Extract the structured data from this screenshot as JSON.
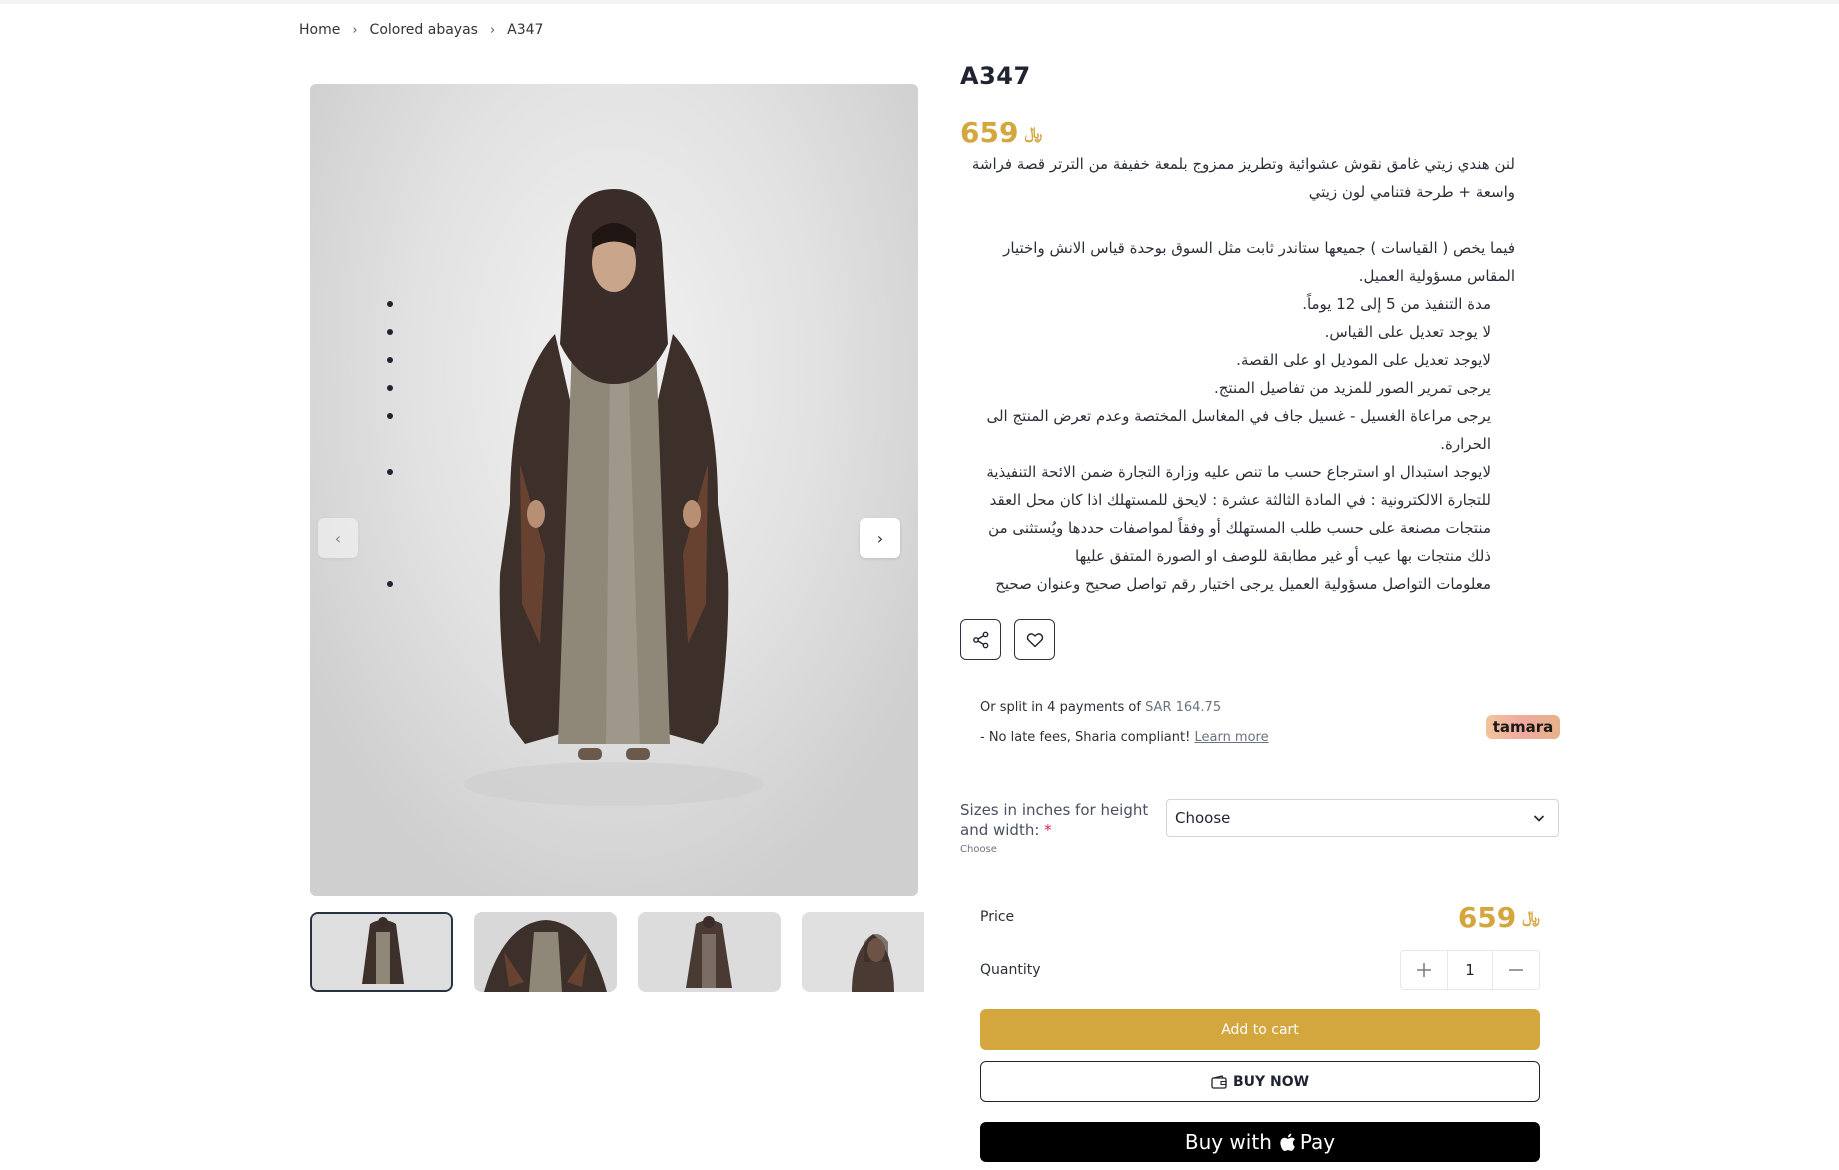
{
  "breadcrumb": {
    "items": [
      "Home",
      "Colored abayas",
      "A347"
    ],
    "separator": "›"
  },
  "product": {
    "title": "A347",
    "price": "659",
    "currency_symbol": "ر.س"
  },
  "description": {
    "paragraph1": "لنن هندي زيتي غامق نقوش عشوائية وتطريز ممزوج بلمعة خفيفة من الترتر قصة فراشة واسعة + طرحة فتنامي لون زيتي",
    "paragraph2": "فيما يخص ( القياسات ) جميعها ستاندر ثابت مثل السوق بوحدة قياس الانش واختيار المقاس مسؤولية العميل.",
    "bullets": [
      "مدة التنفيذ من 5 إلى 12 يوماً.",
      "لا يوجد تعديل على القياس.",
      "لايوجد تعديل على الموديل او على القصة.",
      "يرجى تمرير الصور للمزيد من تفاصيل المنتج.",
      "يرجى مراعاة الغسيل - غسيل جاف في المغاسل المختصة وعدم تعرض المنتج الى الحرارة.",
      "لايوجد استبدال او استرجاع حسب ما تنص عليه وزارة التجارة ضمن الائحة التنفيذية للتجارة الالكترونية : في المادة الثالثة عشرة : لايحق للمستهلك اذا كان محل العقد منتجات مصنعة على حسب طلب المستهلك أو وفقاً لمواصفات حددها ويُستثنى من ذلك منتجات بها عيب أو غير مطابقة للوصف او الصورة المتفق عليها",
      "معلومات التواصل مسؤولية العميل يرجى اختيار رقم تواصل صحيح وعنوان صحيح"
    ]
  },
  "installments": {
    "prefix": "Or split in 4 payments of",
    "amount": "SAR 164.75",
    "note": "- No late fees, Sharia compliant!",
    "learn_more": "Learn more",
    "provider": "tamara"
  },
  "options": {
    "size_label": "Sizes in inches for height and width:",
    "required_mark": "*",
    "size_hint": "Choose",
    "select_value": "Choose"
  },
  "purchase": {
    "price_label": "Price",
    "price_value": "659",
    "quantity_label": "Quantity",
    "quantity_value": "1",
    "add_to_cart": "Add to cart",
    "buy_now": "BUY NOW",
    "apple_pay_text": "Buy with",
    "apple_pay_brand": "Pay"
  },
  "gallery": {
    "prev_icon": "chevron-left-icon",
    "next_icon": "chevron-right-icon",
    "thumbnail_count": 4
  },
  "colors": {
    "accent": "#d4a63e",
    "dark": "#1f2430",
    "apple_pay_bg": "#000000"
  }
}
